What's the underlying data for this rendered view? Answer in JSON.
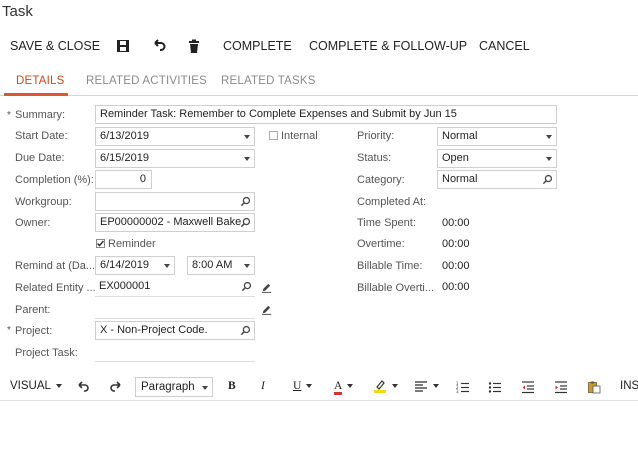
{
  "page": {
    "title": "Task"
  },
  "toolbar": {
    "save_close": "SAVE & CLOSE",
    "complete": "COMPLETE",
    "complete_followup": "COMPLETE & FOLLOW-UP",
    "cancel": "CANCEL"
  },
  "tabs": [
    "DETAILS",
    "RELATED ACTIVITIES",
    "RELATED TASKS"
  ],
  "left": {
    "summary": {
      "label": "Summary:",
      "value": "Reminder Task: Remember to Complete Expenses and Submit by Jun 15"
    },
    "start_date": {
      "label": "Start Date:",
      "value": "6/13/2019"
    },
    "internal": {
      "label": "Internal",
      "checked": false
    },
    "due_date": {
      "label": "Due Date:",
      "value": "6/15/2019"
    },
    "completion": {
      "label": "Completion (%):",
      "value": "0"
    },
    "workgroup": {
      "label": "Workgroup:",
      "value": ""
    },
    "owner": {
      "label": "Owner:",
      "value": "EP00000002 - Maxwell Bake"
    },
    "reminder": {
      "label": "Reminder",
      "checked": true
    },
    "remind_at": {
      "label": "Remind at (Da...",
      "date": "6/14/2019",
      "time": "8:00 AM"
    },
    "related_entity": {
      "label": "Related Entity ...",
      "value": "EX000001"
    },
    "parent": {
      "label": "Parent:",
      "value": ""
    },
    "project": {
      "label": "Project:",
      "value": "X - Non-Project Code."
    },
    "project_task": {
      "label": "Project Task:",
      "value": ""
    }
  },
  "right": {
    "priority": {
      "label": "Priority:",
      "value": "Normal"
    },
    "status": {
      "label": "Status:",
      "value": "Open"
    },
    "category": {
      "label": "Category:",
      "value": "Normal"
    },
    "completed_at": {
      "label": "Completed At:",
      "value": ""
    },
    "time_spent": {
      "label": "Time Spent:",
      "value": "00:00"
    },
    "overtime": {
      "label": "Overtime:",
      "value": "00:00"
    },
    "billable_time": {
      "label": "Billable Time:",
      "value": "00:00"
    },
    "billable_overtime": {
      "label": "Billable Overti...",
      "value": "00:00"
    }
  },
  "editor": {
    "visual": "VISUAL",
    "paragraph": "Paragraph",
    "bold": "B",
    "italic": "I",
    "underline": "U",
    "font_color": "A",
    "insert": "INS"
  },
  "colors": {
    "accent": "#d95a2b",
    "active_tab_text": "#c44a1f",
    "highlight": "#f5d90a",
    "font_color_bar": "#d0342c"
  }
}
